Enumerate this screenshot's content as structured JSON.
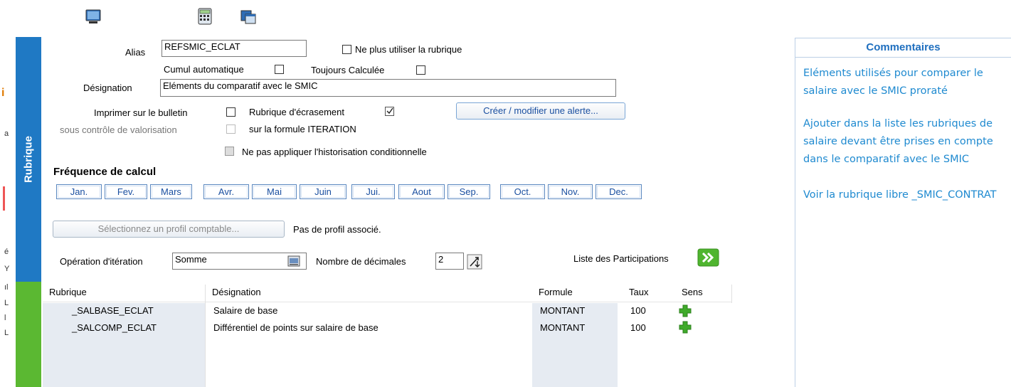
{
  "left_edge_fragments": [
    "i",
    "a",
    "é",
    "Y",
    "ıl",
    "L",
    "l",
    "L"
  ],
  "side_bands": {
    "blue_label": "Rubrique"
  },
  "form": {
    "alias_label": "Alias",
    "alias_value": "REFSMIC_ECLAT",
    "ne_plus_utiliser_label": "Ne plus utiliser la rubrique",
    "cumul_label": "Cumul automatique",
    "toujours_label": "Toujours Calculée",
    "designation_label": "Désignation",
    "designation_value": "Eléments du comparatif avec le SMIC",
    "imprimer_label": "Imprimer sur le bulletin",
    "sous_controle_label": "sous contrôle de valorisation",
    "ecrasement_label": "Rubrique d'écrasement",
    "iteration_formule_label": "sur la formule ITERATION",
    "alerte_button": "Créer / modifier une alerte...",
    "historisation_label": "Ne pas appliquer l'historisation conditionnelle"
  },
  "frequence": {
    "title": "Fréquence de calcul",
    "months": [
      "Jan.",
      "Fev.",
      "Mars",
      "Avr.",
      "Mai",
      "Juin",
      "Jui.",
      "Aout",
      "Sep.",
      "Oct.",
      "Nov.",
      "Dec."
    ]
  },
  "profil": {
    "button": "Sélectionnez un profil comptable...",
    "status": "Pas de profil associé."
  },
  "iteration": {
    "operation_label": "Opération d'itération",
    "operation_value": "Somme",
    "decimales_label": "Nombre de décimales",
    "decimales_value": "2",
    "participations_label": "Liste des Participations"
  },
  "table": {
    "headers": {
      "rubrique": "Rubrique",
      "designation": "Désignation",
      "formule": "Formule",
      "taux": "Taux",
      "sens": "Sens"
    },
    "rows": [
      {
        "rubrique": "_SALBASE_ECLAT",
        "designation": "Salaire de base",
        "formule": "MONTANT",
        "taux": "100",
        "sens": "plus-icon"
      },
      {
        "rubrique": "_SALCOMP_ECLAT",
        "designation": "Différentiel de points sur salaire de base",
        "formule": "MONTANT",
        "taux": "100",
        "sens": "plus-icon"
      }
    ]
  },
  "comments": {
    "title": "Commentaires",
    "paragraphs": [
      "Eléments utilisés pour comparer le salaire avec le SMIC proraté",
      "Ajouter dans la liste les rubriques de salaire devant être prises en compte dans le comparatif avec le SMIC",
      "Voir la rubrique libre _SMIC_CONTRAT"
    ]
  },
  "colors": {
    "blue_band": "#1f79c4",
    "green_band": "#5bb832",
    "comment_text": "#1f8ad0",
    "comment_title": "#1f6fbf",
    "plus_icon": "#3faa2a"
  }
}
